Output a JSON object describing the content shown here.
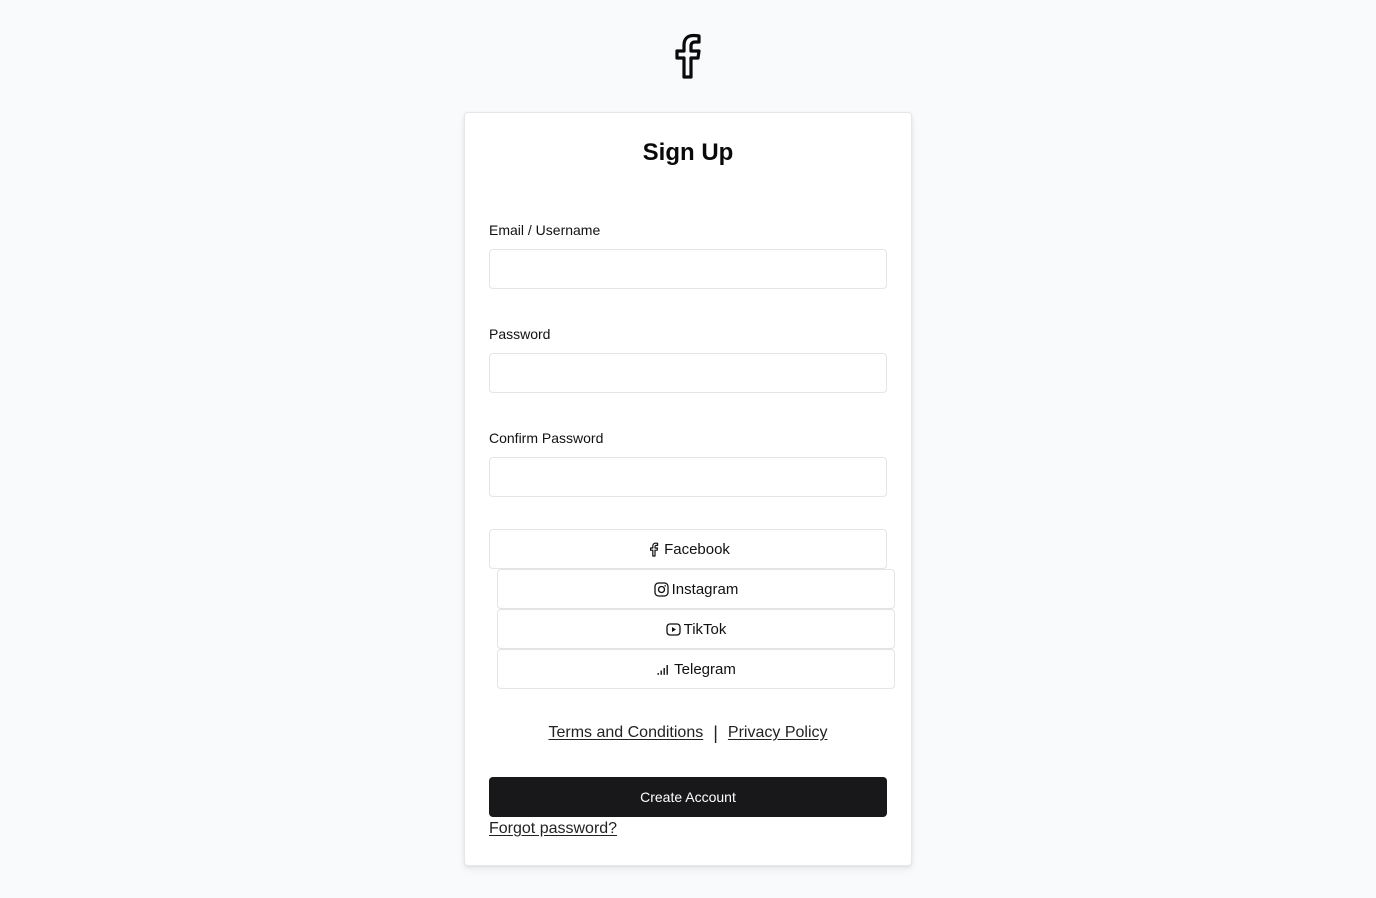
{
  "logo": {
    "icon": "facebook-icon"
  },
  "form": {
    "title": "Sign Up",
    "fields": [
      {
        "label": "Email / Username",
        "value": "",
        "placeholder": ""
      },
      {
        "label": "Password",
        "value": "",
        "placeholder": ""
      },
      {
        "label": "Confirm Password",
        "value": "",
        "placeholder": ""
      }
    ]
  },
  "social": [
    {
      "label": "Facebook",
      "icon": "facebook-icon"
    },
    {
      "label": "Instagram",
      "icon": "instagram-icon"
    },
    {
      "label": "TikTok",
      "icon": "youtube-icon"
    },
    {
      "label": "Telegram",
      "icon": "signal-bars-icon"
    }
  ],
  "links": {
    "terms": "Terms and Conditions",
    "separator": "|",
    "privacy": "Privacy Policy"
  },
  "actions": {
    "create_label": "Create Account",
    "forgot_label": "Forgot password?"
  },
  "colors": {
    "background": "#f9fafb",
    "card": "#ffffff",
    "primary_button": "#18181b",
    "border": "#e4e4e7"
  }
}
